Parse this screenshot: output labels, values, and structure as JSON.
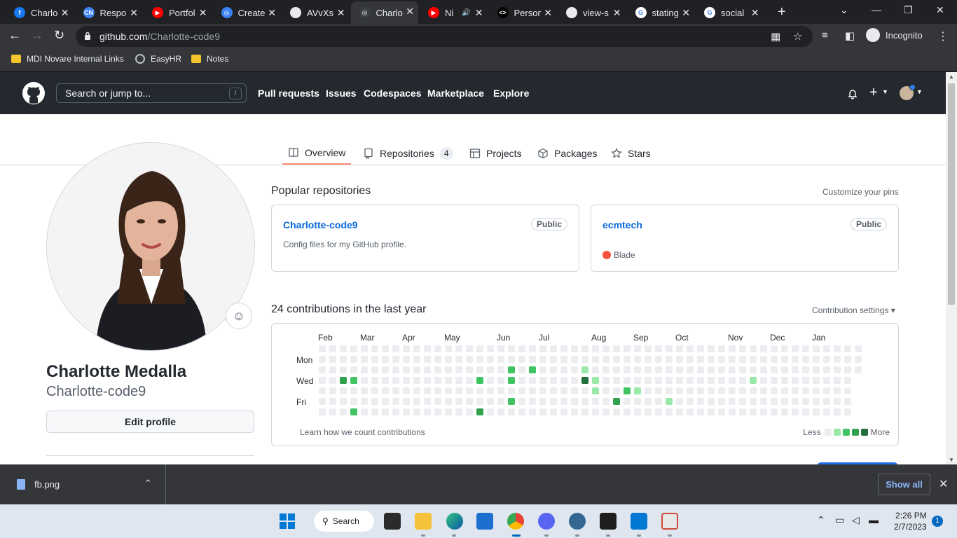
{
  "browser": {
    "tabs": [
      {
        "label": "Charlo",
        "icon": "facebook-icon",
        "color": "#1877f2",
        "glyph": "f"
      },
      {
        "label": "Respo",
        "icon": "codenewbie-icon",
        "color": "#3b82f6",
        "glyph": "CN"
      },
      {
        "label": "Portfol",
        "icon": "youtube-icon",
        "color": "#ff0000",
        "glyph": "▶"
      },
      {
        "label": "Create",
        "icon": "github-icon",
        "color": "#3b82f6",
        "glyph": "◎"
      },
      {
        "label": "AVvXsl",
        "icon": "globe-icon",
        "color": "#e8eaed",
        "glyph": ""
      },
      {
        "label": "Charlo",
        "icon": "github-icon",
        "color": "#3c4043",
        "glyph": "◎",
        "active": true
      },
      {
        "label": "Ni",
        "icon": "youtube-icon",
        "color": "#ff0000",
        "glyph": "▶",
        "audio": true
      },
      {
        "label": "Person",
        "icon": "code-icon",
        "color": "#000000",
        "glyph": "<>"
      },
      {
        "label": "view-s",
        "icon": "globe-icon",
        "color": "#e8eaed",
        "glyph": ""
      },
      {
        "label": "stating",
        "icon": "google-icon",
        "color": "#ffffff",
        "glyph": "G"
      },
      {
        "label": "social",
        "icon": "google-icon",
        "color": "#ffffff",
        "glyph": "G"
      }
    ],
    "url_host": "github.com",
    "url_path": "/Charlotte-code9",
    "incognito_label": "Incognito",
    "bookmarks": [
      {
        "label": "MDI Novare Internal Links",
        "icon": "folder-icon"
      },
      {
        "label": "EasyHR",
        "icon": "globe-icon"
      },
      {
        "label": "Notes",
        "icon": "folder-icon"
      }
    ]
  },
  "github": {
    "search_placeholder": "Search or jump to...",
    "search_key": "/",
    "nav": [
      "Pull requests",
      "Issues",
      "Codespaces",
      "Marketplace",
      "Explore"
    ],
    "tabs": {
      "overview": "Overview",
      "repositories": "Repositories",
      "repositories_count": "4",
      "projects": "Projects",
      "packages": "Packages",
      "stars": "Stars"
    },
    "profile": {
      "full_name": "Charlotte Medalla",
      "username": "Charlotte-code9",
      "edit_label": "Edit profile"
    },
    "popular": {
      "title": "Popular repositories",
      "customize": "Customize your pins",
      "repos": [
        {
          "name": "Charlotte-code9",
          "visibility": "Public",
          "description": "Config files for my GitHub profile.",
          "language": ""
        },
        {
          "name": "ecmtech",
          "visibility": "Public",
          "description": "",
          "language": "Blade",
          "language_color": "#f7523f"
        }
      ]
    },
    "contributions": {
      "title": "24 contributions in the last year",
      "settings": "Contribution settings ▾",
      "months": [
        "Feb",
        "Mar",
        "Apr",
        "May",
        "Jun",
        "Jul",
        "Aug",
        "Sep",
        "Oct",
        "Nov",
        "Dec",
        "Jan"
      ],
      "days": [
        "Mon",
        "Wed",
        "Fri"
      ],
      "learn": "Learn how we count contributions",
      "legend_less": "Less",
      "legend_more": "More",
      "levels": [
        "#ebedf0",
        "#9be9a8",
        "#40c463",
        "#30a14e",
        "#216e39"
      ],
      "active_cells": [
        {
          "week": 2,
          "day": 3,
          "level": 3
        },
        {
          "week": 3,
          "day": 3,
          "level": 2
        },
        {
          "week": 3,
          "day": 6,
          "level": 2
        },
        {
          "week": 15,
          "day": 3,
          "level": 2
        },
        {
          "week": 15,
          "day": 6,
          "level": 3
        },
        {
          "week": 18,
          "day": 2,
          "level": 2
        },
        {
          "week": 18,
          "day": 3,
          "level": 2
        },
        {
          "week": 18,
          "day": 5,
          "level": 2
        },
        {
          "week": 20,
          "day": 2,
          "level": 2
        },
        {
          "week": 25,
          "day": 2,
          "level": 1
        },
        {
          "week": 25,
          "day": 3,
          "level": 4
        },
        {
          "week": 26,
          "day": 3,
          "level": 1
        },
        {
          "week": 26,
          "day": 4,
          "level": 1
        },
        {
          "week": 28,
          "day": 5,
          "level": 3
        },
        {
          "week": 29,
          "day": 4,
          "level": 2
        },
        {
          "week": 30,
          "day": 4,
          "level": 1
        },
        {
          "week": 33,
          "day": 5,
          "level": 1
        },
        {
          "week": 41,
          "day": 3,
          "level": 1
        }
      ]
    }
  },
  "downloads": {
    "file": "fb.png",
    "show_all": "Show all"
  },
  "taskbar": {
    "search_label": "Search",
    "time": "2:26 PM",
    "date": "2/7/2023",
    "notifications": "1"
  }
}
